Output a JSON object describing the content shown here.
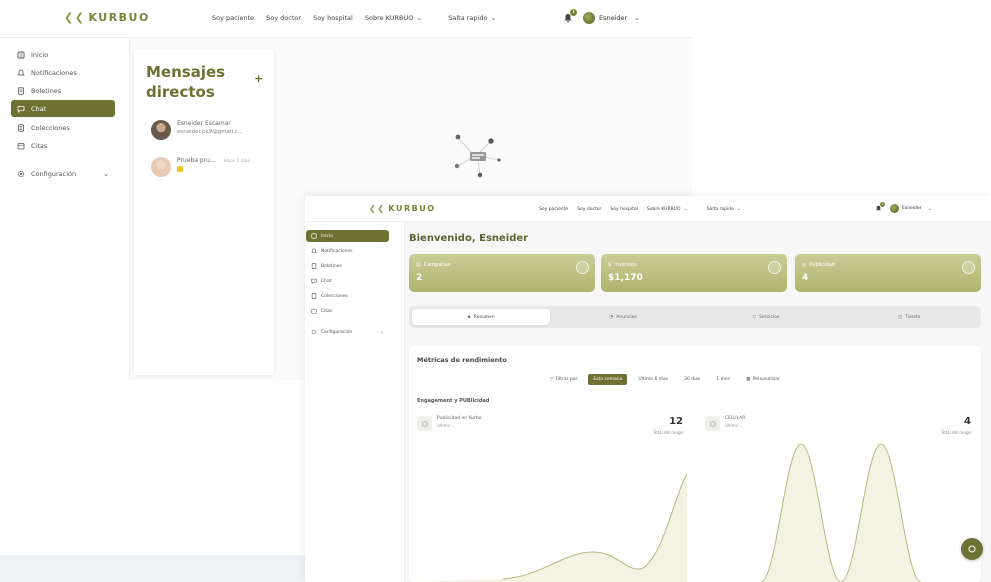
{
  "brand": {
    "logo_text": "KURBUO",
    "accent": "#6d7232"
  },
  "back_window": {
    "nav": {
      "links": [
        "Soy paciente",
        "Soy doctor",
        "Soy hospital"
      ],
      "dropdown_1": "Sobre KURBUO",
      "dropdown_2": "Salta rapido",
      "notification_count": "1",
      "user_name": "Esneider"
    },
    "sidebar": {
      "items": [
        {
          "label": "Inicio",
          "icon": "home-icon"
        },
        {
          "label": "Notificaciones",
          "icon": "bell-icon"
        },
        {
          "label": "Boletines",
          "icon": "document-icon"
        },
        {
          "label": "Chat",
          "icon": "chat-icon"
        },
        {
          "label": "Colecciones",
          "icon": "list-icon"
        },
        {
          "label": "Citas",
          "icon": "calendar-icon"
        },
        {
          "label": "Configuración",
          "icon": "gear-icon"
        }
      ],
      "active_index": 3
    },
    "messages": {
      "title": "Mensajes directos",
      "contacts": [
        {
          "name": "Esneider Escamar",
          "sub": "esneider.pk9@gmail.c..."
        },
        {
          "name": "Prueba pru...",
          "sub": "",
          "time": "Hace 2 dias"
        }
      ]
    }
  },
  "front_window": {
    "nav": {
      "links": [
        "Soy paciente",
        "Soy doctor",
        "Soy hospital"
      ],
      "dropdown_1": "Sobre KURBUO",
      "dropdown_2": "Salta rapido",
      "notification_count": "1",
      "user_name": "Esneider"
    },
    "sidebar": {
      "items": [
        {
          "label": "Inicio",
          "icon": "home-icon"
        },
        {
          "label": "Notificaciones",
          "icon": "bell-icon"
        },
        {
          "label": "Boletines",
          "icon": "document-icon"
        },
        {
          "label": "Chat",
          "icon": "chat-icon"
        },
        {
          "label": "Colecciones",
          "icon": "list-icon"
        },
        {
          "label": "Citas",
          "icon": "calendar-icon"
        },
        {
          "label": "Configuración",
          "icon": "gear-icon"
        }
      ],
      "active_index": 0
    },
    "welcome": "Bienvenido, Esneider",
    "stats": [
      {
        "label": "Campañas",
        "value": "2"
      },
      {
        "label": "Inversión",
        "value": "$1,170"
      },
      {
        "label": "Publicidad",
        "value": "4"
      }
    ],
    "tabs": [
      {
        "label": "Resumen",
        "active": true
      },
      {
        "label": "Anuncios",
        "active": false
      },
      {
        "label": "Servicios",
        "active": false
      },
      {
        "label": "Tienda",
        "active": false
      }
    ],
    "metrics": {
      "title": "Métricas de rendimiento",
      "filters": [
        {
          "label": "Filtrar por",
          "active": false
        },
        {
          "label": "Esta semana",
          "active": true
        },
        {
          "label": "Ultimo 6 dias",
          "active": false
        },
        {
          "label": "30 dias",
          "active": false
        },
        {
          "label": "1 mes",
          "active": false
        },
        {
          "label": "Personalizar",
          "active": false
        }
      ],
      "section_label": "Engagement y PUBlicidad",
      "charts": [
        {
          "name": "Publicidad en Kurbo",
          "sub": "Ultimo",
          "value": "12",
          "value_label": "Total del rango"
        },
        {
          "name": "CELULAR",
          "sub": "Ultimo",
          "value": "4",
          "value_label": "Total del rango"
        }
      ]
    }
  }
}
